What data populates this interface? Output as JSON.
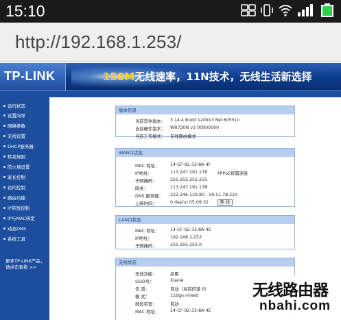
{
  "status_bar": {
    "time": "15:10",
    "icons": [
      "sim-card-icon",
      "vibrate-icon",
      "wifi-icon",
      "signal-icon",
      "battery-icon"
    ]
  },
  "browser": {
    "url": "http://192.168.1.253/"
  },
  "header": {
    "logo": "TP-LINK",
    "slogan_speed": "150M",
    "slogan_rest": "无线速率，11N技术，无线生活新选择"
  },
  "sidebar": {
    "items": [
      {
        "label": "运行状态"
      },
      {
        "label": "设置向导"
      },
      {
        "label": "网络参数"
      },
      {
        "label": "无线设置"
      },
      {
        "label": "DHCP服务器"
      },
      {
        "label": "转发规则"
      },
      {
        "label": "防火墙设置"
      },
      {
        "label": "家长控制"
      },
      {
        "label": "访问控制"
      },
      {
        "label": "路由功能"
      },
      {
        "label": "IP带宽控制"
      },
      {
        "label": "IP与MAC绑定"
      },
      {
        "label": "动态DNS"
      },
      {
        "label": "系统工具"
      }
    ],
    "more_line1": "更多TP-LINK产品，",
    "more_line2": "请点击查看 >>"
  },
  "panels": {
    "version": {
      "title": "版本信息",
      "rows": [
        {
          "label": "当前软件版本：",
          "value": "3.14.4 Build 120913 Rel.60551n"
        },
        {
          "label": "当前硬件版本：",
          "value": "WR720N v3 00000000"
        },
        {
          "label": "当前工作模式：",
          "value": "无线路由模式"
        }
      ]
    },
    "wan": {
      "title": "WAN口状态",
      "rows": [
        {
          "label": "MAC 地址：",
          "value": "14-CF-92-33-8A-4F"
        },
        {
          "label": "IP地址：",
          "value": "113.247.191.178",
          "extra": "PPPoE按需连接"
        },
        {
          "label": "子网掩码：",
          "value": "255.255.255.255"
        },
        {
          "label": "网关：",
          "value": "113.247.191.178"
        },
        {
          "label": "DNS 服务器：",
          "value": "222.246.129.80 , 59.51.78.210"
        },
        {
          "label": "上网时间：",
          "value": "0 day(s) 05:09:32",
          "button": "断 线"
        }
      ]
    },
    "lan": {
      "title": "LAN口状态",
      "rows": [
        {
          "label": "MAC 地址：",
          "value": "14-CF-92-33-8A-4E"
        },
        {
          "label": "IP地址：",
          "value": "192.168.1.253"
        },
        {
          "label": "子网掩码：",
          "value": "255.255.255.0"
        }
      ]
    },
    "wireless": {
      "title": "无线状态",
      "rows": [
        {
          "label": "无线功能：",
          "value": "启用"
        },
        {
          "label": "SSID号：",
          "value": "Xiaole"
        },
        {
          "label": "信 道：",
          "value": "自动（当前信道 6）"
        },
        {
          "label": "模 式：",
          "value": "11bgn mixed"
        },
        {
          "label": "频段带宽：",
          "value": "自动"
        },
        {
          "label": "MAC 地址：",
          "value": "14-CF-92-33-8A-4E"
        }
      ]
    }
  },
  "watermark": {
    "chinese": "无线路由器",
    "domain": "nbahi.com"
  }
}
